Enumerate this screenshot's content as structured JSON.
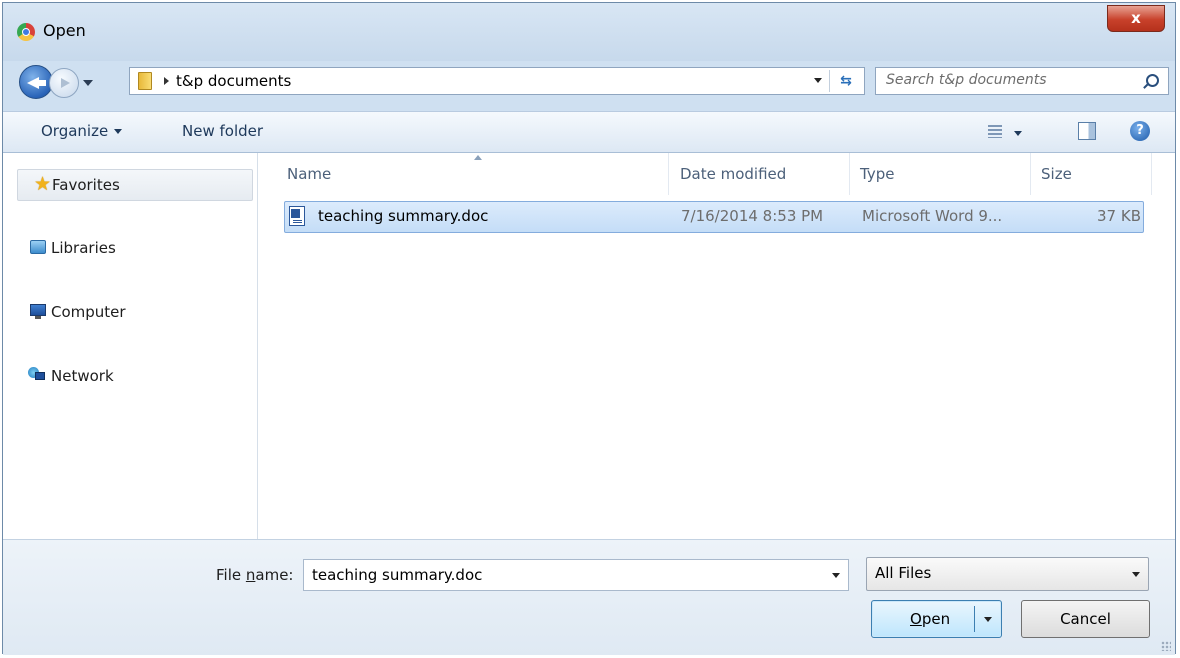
{
  "title_bar": {
    "title": "Open",
    "close_label": "x"
  },
  "nav": {
    "breadcrumb": "t&p documents",
    "search_placeholder": "Search t&p documents"
  },
  "toolbar": {
    "organize_label": "Organize",
    "new_folder_label": "New folder"
  },
  "sidebar": {
    "items": [
      {
        "label": "Favorites",
        "icon": "star-icon"
      },
      {
        "label": "Libraries",
        "icon": "library-icon"
      },
      {
        "label": "Computer",
        "icon": "computer-icon"
      },
      {
        "label": "Network",
        "icon": "network-icon"
      }
    ]
  },
  "file_list": {
    "columns": [
      "Name",
      "Date modified",
      "Type",
      "Size"
    ],
    "rows": [
      {
        "name": "teaching summary.doc",
        "date_modified": "7/16/2014 8:53 PM",
        "type": "Microsoft Word 9...",
        "size": "37 KB"
      }
    ]
  },
  "bottom": {
    "file_name_label_prefix": "File ",
    "file_name_label_mnemonic": "n",
    "file_name_label_suffix": "ame:",
    "file_name_value": "teaching summary.doc",
    "filter_value": "All Files",
    "open_label_mnemonic": "O",
    "open_label_rest": "pen",
    "cancel_label": "Cancel"
  },
  "colors": {
    "selection": "#cce4f9",
    "titlebar": "#d0e0f1",
    "close": "#c8412b"
  }
}
